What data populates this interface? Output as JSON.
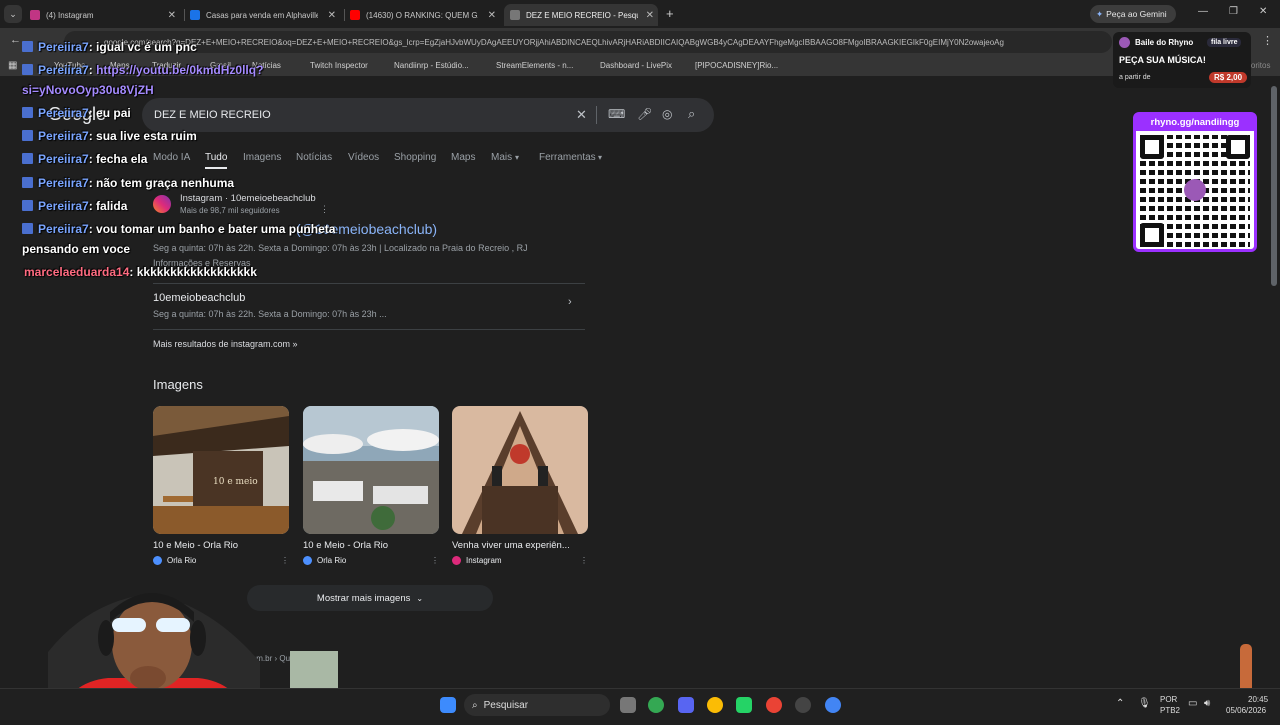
{
  "tabs": [
    {
      "title": "(4) Instagram",
      "color": "#c13584"
    },
    {
      "title": "Casas para venda em Alphaville",
      "color": "#1a73e8"
    },
    {
      "title": "(14630) O RANKING: QUEM GA",
      "color": "#ff0000"
    },
    {
      "title": "DEZ E MEIO RECREIO - Pesqui",
      "color": "#777777"
    }
  ],
  "gemini_label": "Peça ao Gemini",
  "address": "google.com/search?q=DEZ+E+MEIO+RECREIO&oq=DEZ+E+MEIO+RECREIO&gs_lcrp=EgZjaHJvbWUyDAgAEEUYORjjAhiABDINCAEQLhivARjHARiABDIICAIQABgWGB4yCAgDEAAYFhgeMgcIBBAAGO8FMgoIBRAAGKIEGIkF0gEIMjY0N2owajeoAg",
  "bookmarks": [
    "YouTube",
    "Maps",
    "Traduzir",
    "Gmail",
    "Notícias",
    "Twitch Inspector",
    "Nandiinrp - Estúdio...",
    "StreamElements - n...",
    "Dashboard - LivePix",
    "[PIPOCADISNEY]Rio..."
  ],
  "all_favorites": "Todos os favoritos",
  "search": {
    "logo": "Google",
    "query": "DEZ E MEIO RECREIO"
  },
  "nav_tabs": [
    "Modo IA",
    "Tudo",
    "Imagens",
    "Notícias",
    "Vídeos",
    "Shopping",
    "Maps",
    "Mais",
    "Ferramentas"
  ],
  "result": {
    "site": "Instagram · 10emeioebeachclub",
    "followers": "Mais de 98,7 mil seguidores",
    "title": "(@10emeiobeachclub)",
    "hours": "Seg a quinta: 07h às 22h. Sexta a Domingo: 07h às 23h | Localizado na Praia do Recreio , RJ",
    "info": "Informações e Reservas",
    "sub_title": "10emeiobeachclub",
    "sub_snippet": "Seg a quinta: 07h às 22h. Sexta a Domingo: 07h às 23h ...",
    "more": "Mais resultados de instagram.com »"
  },
  "images_heading": "Imagens",
  "images": [
    {
      "title": "10 e Meio - Orla Rio",
      "source": "Orla Rio"
    },
    {
      "title": "10 e Meio - Orla Rio",
      "source": "Orla Rio"
    },
    {
      "title": "Venha viver uma experiên...",
      "source": "Instagram"
    }
  ],
  "show_more_images": "Mostrar mais imagens",
  "bottom_source": "diario.com.br › Quiosque",
  "chat": [
    {
      "user": "Pereiira7",
      "msg": ": igual vc é um pnc"
    },
    {
      "user": "Pereiira7",
      "msg": ": ",
      "link": "https://youtu.be/0kmdHz0llq?"
    },
    {
      "user": "",
      "msg": "",
      "link": "si=yNovoOyp30u8VjZH"
    },
    {
      "user": "Pereiira7",
      "msg": ": eu pai"
    },
    {
      "user": "Pereiira7",
      "msg": ": sua live esta ruim"
    },
    {
      "user": "Pereiira7",
      "msg": ": fecha ela"
    },
    {
      "user": "Pereiira7",
      "msg": ": não tem graça nenhuma"
    },
    {
      "user": "Pereiira7",
      "msg": ": falida"
    },
    {
      "user": "Pereiira7",
      "msg": ": vou tomar um banho e bater uma punheta"
    },
    {
      "user": "",
      "msg": "pensando em voce"
    },
    {
      "user": "marcelaeduarda14",
      "msg": ": kkkkkkkkkkkkkkkkkk"
    }
  ],
  "overlay": {
    "title": "Baile do Rhyno",
    "badge": "fila livre",
    "cta": "PEÇA SUA MÚSICA!",
    "from": "a partir de",
    "price": "R$ 2,00",
    "url": "rhyno.gg/nandiingg"
  },
  "taskbar": {
    "search": "Pesquisar",
    "lang": "POR",
    "lang2": "PTB2",
    "time": "20:45",
    "date": "05/06/2026"
  }
}
